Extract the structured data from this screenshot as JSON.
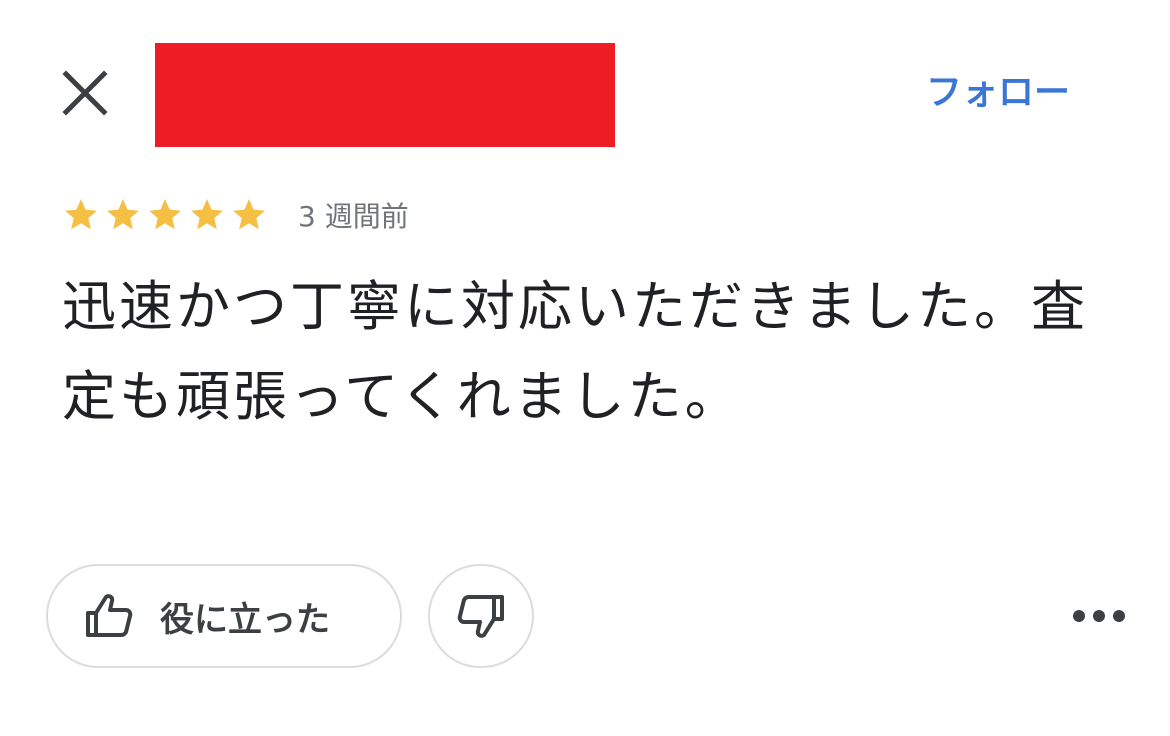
{
  "header": {
    "close_icon": "close-icon",
    "follow_label": "フォロー",
    "follow_color": "#3a76d6",
    "redaction_color": "#ee1c25"
  },
  "review": {
    "rating": 5,
    "rating_max": 5,
    "star_icon": "star-icon",
    "star_color": "#f4bf42",
    "time_ago": "3 週間前",
    "text": "迅速かつ丁寧に対応いただきました。査定も頑張ってくれました。"
  },
  "actions": {
    "helpful_icon": "thumb-up-icon",
    "helpful_label": "役に立った",
    "not_helpful_icon": "thumb-down-icon",
    "more_icon": "more-horizontal-icon"
  }
}
